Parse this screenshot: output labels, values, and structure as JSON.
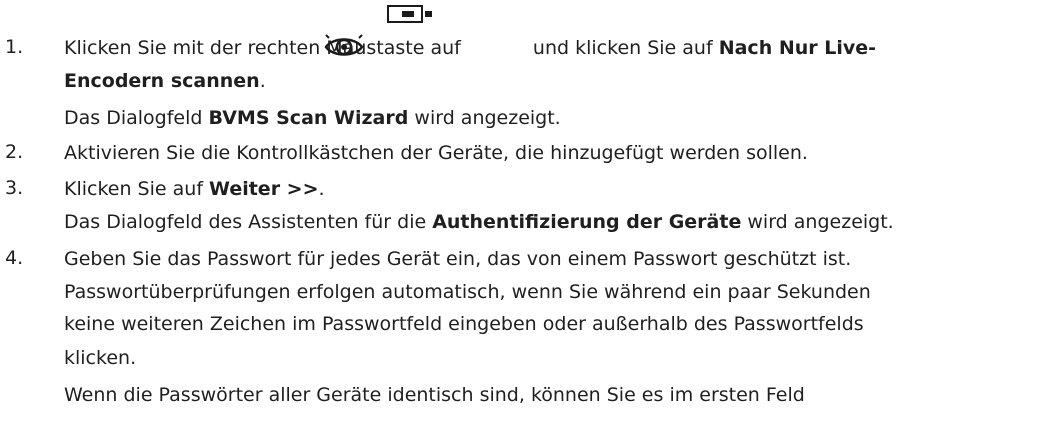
{
  "steps": [
    {
      "number": "1.",
      "lines": [
        {
          "pre": "Klicken Sie mit der rechten Maustaste auf",
          "mid": "und klicken Sie auf ",
          "bold": "Nach Nur Live-"
        },
        {
          "bold": "Encodern scannen",
          "post": "."
        },
        {
          "pre": "Das Dialogfeld ",
          "bold": "BVMS Scan Wizard",
          "post": " wird angezeigt."
        }
      ]
    },
    {
      "number": "2.",
      "text": "Aktivieren Sie die Kontrollkästchen der Geräte, die hinzugefügt werden sollen."
    },
    {
      "number": "3.",
      "lines": [
        {
          "pre": "Klicken Sie auf ",
          "bold": "Weiter >>",
          "post": "."
        },
        {
          "pre": "Das Dialogfeld des Assistenten für die ",
          "bold": "Authentifizierung der Geräte",
          "post": " wird angezeigt."
        }
      ]
    },
    {
      "number": "4.",
      "lines": [
        "Geben Sie das Passwort für jedes Gerät ein, das von einem Passwort geschützt ist.",
        "Passwortüberprüfungen erfolgen automatisch, wenn Sie während ein paar Sekunden",
        "keine weiteren Zeichen im Passwortfeld eingeben oder außerhalb des Passwortfelds",
        "klicken.",
        "Wenn die Passwörter aller Geräte identisch sind, können Sie es im ersten Feld"
      ]
    }
  ],
  "icons": [
    "monitor-icon",
    "live-encoder-eye-icon"
  ]
}
